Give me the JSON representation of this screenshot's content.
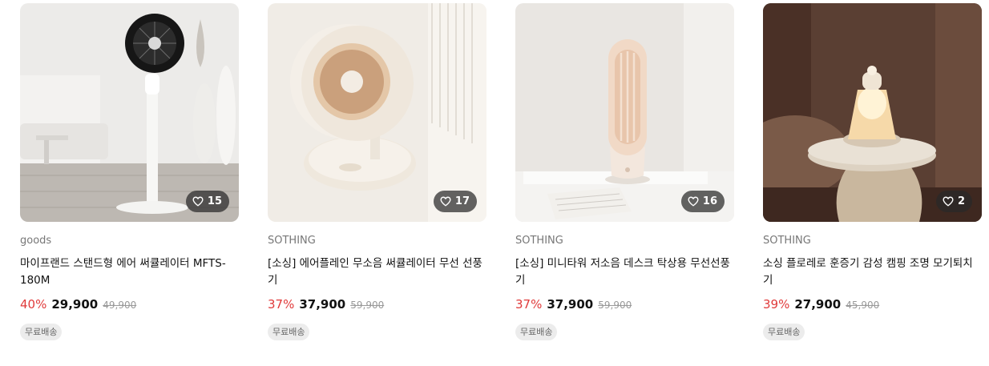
{
  "products": [
    {
      "brand": "goods",
      "title": "마이프랜드 스탠드형 에어 써큘레이터 MFTS-180M",
      "discount": "40%",
      "price": "29,900",
      "original_price": "49,900",
      "likes": "15",
      "shipping": "무료배송"
    },
    {
      "brand": "SOTHING",
      "title": "[소싱] 에어플레인 무소음 써큘레이터 무선 선풍기",
      "discount": "37%",
      "price": "37,900",
      "original_price": "59,900",
      "likes": "17",
      "shipping": "무료배송"
    },
    {
      "brand": "SOTHING",
      "title": "[소싱] 미니타워 저소음 데스크 탁상용 무선선풍기",
      "discount": "37%",
      "price": "37,900",
      "original_price": "59,900",
      "likes": "16",
      "shipping": "무료배송"
    },
    {
      "brand": "SOTHING",
      "title": "소싱 플로레로 훈증기 감성 캠핑 조명 모기퇴치기",
      "discount": "39%",
      "price": "27,900",
      "original_price": "45,900",
      "likes": "2",
      "shipping": "무료배송"
    }
  ],
  "colors": {
    "discount": "#e03a3a",
    "badge_bg": "#ececec",
    "like_bg": "#282828"
  }
}
